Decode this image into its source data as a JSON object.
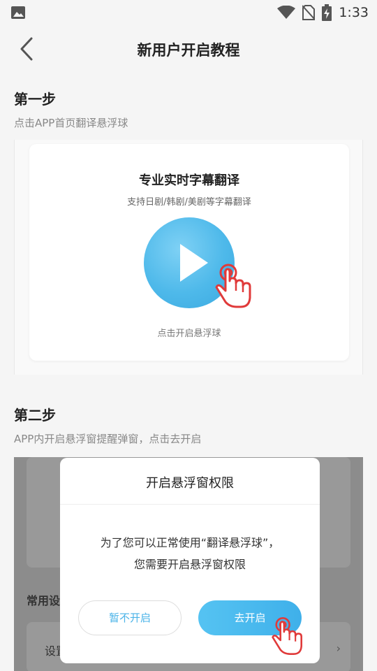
{
  "status_bar": {
    "time": "1:33",
    "icons": [
      "gallery-icon",
      "wifi-icon",
      "no-sim-icon",
      "battery-charging-icon"
    ]
  },
  "header": {
    "title": "新用户开启教程",
    "back_icon": "chevron-left-icon"
  },
  "step1": {
    "title": "第一步",
    "description": "点击APP首页翻译悬浮球",
    "card": {
      "title": "专业实时字幕翻译",
      "subtitle": "支持日剧/韩剧/美剧等字幕翻译",
      "caption": "点击开启悬浮球"
    }
  },
  "step2": {
    "title": "第二步",
    "description": "APP内开启悬浮窗提醒弹窗，点击去开启",
    "background": {
      "section_label": "常用设",
      "row_label": "设置",
      "chevron": "›"
    },
    "dialog": {
      "title": "开启悬浮窗权限",
      "message_line1": "为了您可以正常使用“翻译悬浮球”，",
      "message_line2": "您需要开启悬浮窗权限",
      "cancel_label": "暂不开启",
      "confirm_label": "去开启"
    }
  },
  "colors": {
    "accent": "#4ab3e8",
    "hand": "#e03a3a",
    "background": "#f5f5f5"
  }
}
